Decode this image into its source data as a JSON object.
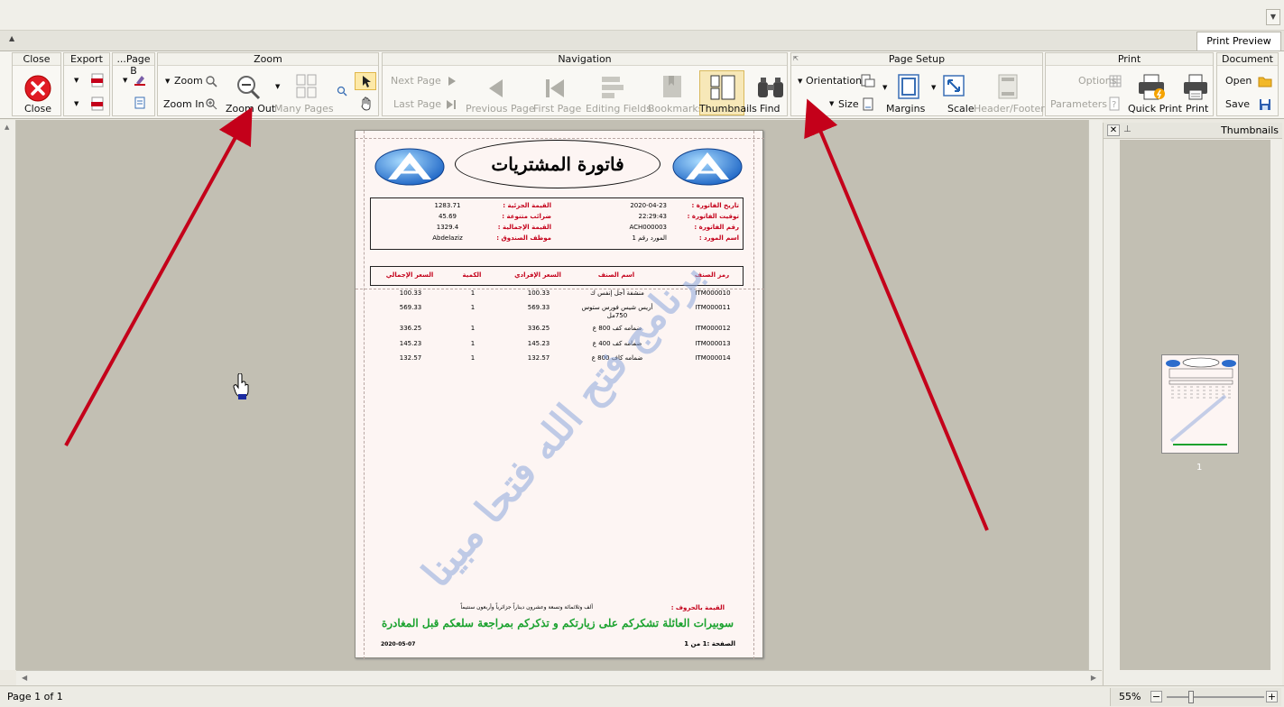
{
  "tab": {
    "label": "Print Preview"
  },
  "groups": {
    "close": {
      "title": "Close",
      "close_label": "Close"
    },
    "export": {
      "title": "Export"
    },
    "pageb": {
      "title": "...Page B"
    },
    "zoom": {
      "title": "Zoom",
      "zoom_label": "Zoom",
      "zoom_in_label": "Zoom In",
      "zoom_out_label": "Zoom Out",
      "many_pages_label": "Many Pages"
    },
    "navigation": {
      "title": "Navigation",
      "next_page": "Next Page",
      "last_page": "Last Page",
      "previous_page": "Previous Page",
      "first_page": "First Page",
      "editing_fields": "Editing Fields",
      "bookmarks": "Bookmarks",
      "thumbnails": "Thumbnails",
      "find": "Find"
    },
    "pagesetup": {
      "title": "Page Setup",
      "orientation": "Orientation",
      "size": "Size",
      "margins": "Margins",
      "scale": "Scale",
      "header_footer": "Header/Footer"
    },
    "print": {
      "title": "Print",
      "options": "Options",
      "parameters": "Parameters",
      "quick_print": "Quick Print",
      "print": "Print"
    },
    "document": {
      "title": "Document",
      "open": "Open",
      "save": "Save"
    }
  },
  "thumbnails_panel": {
    "title": "Thumbnails",
    "page_number": "1"
  },
  "status": {
    "page_info": "Page 1 of 1",
    "zoom": "55%"
  },
  "invoice": {
    "title": "فاتورة المشتريات",
    "info_right": [
      {
        "label": "تاريخ الفاتورة :",
        "value": "2020-04-23"
      },
      {
        "label": "توقيت الفاتورة :",
        "value": "22:29:43"
      },
      {
        "label": "رقم الفاتورة :",
        "value": "ACH000003"
      },
      {
        "label": "اسم المورد :",
        "value": "المورد رقم 1"
      }
    ],
    "info_left": [
      {
        "label": "القيمة الجزئية :",
        "value": "1283.71"
      },
      {
        "label": "ضرائب متنوعة :",
        "value": "45.69"
      },
      {
        "label": "القيمة الإجمالية :",
        "value": "1329.4"
      },
      {
        "label": "موظف الصندوق :",
        "value": "Abdelaziz"
      }
    ],
    "columns": [
      "رمز الصنف",
      "اسم الصنف",
      "السعر الإفرادي",
      "الكمية",
      "السعر الإجمالي"
    ],
    "rows": [
      {
        "code": "ITM000010",
        "name": "منشفة أجل إنفس ك",
        "unit": "100.33",
        "qty": "1",
        "total": "100.33"
      },
      {
        "code": "ITM000011",
        "name": "أريس شيس فورس ستوس 750مل",
        "unit": "569.33",
        "qty": "1",
        "total": "569.33"
      },
      {
        "code": "ITM000012",
        "name": "ضمامه كف 800 ع",
        "unit": "336.25",
        "qty": "1",
        "total": "336.25"
      },
      {
        "code": "ITM000013",
        "name": "ضمامه كف 400 ع",
        "unit": "145.23",
        "qty": "1",
        "total": "145.23"
      },
      {
        "code": "ITM000014",
        "name": "ضمامه كاف 800 ع",
        "unit": "132.57",
        "qty": "1",
        "total": "132.57"
      }
    ],
    "amount_words_label": "القيمة بالحروف :",
    "amount_words": "ألف وثلاثمائة وتسعة وعشرون ديناراً جزائرياً وأربعون سنتيماً",
    "thanks": "سوبيرات العائلة تشكركم على زيارتكم و تذكركم بمراجعة سلعكم قبل المغادرة",
    "page_label": "الصفحة :1 من 1",
    "footer_date": "2020-05-07",
    "watermark": "برنامج فتح الله فتحا مبينا"
  },
  "colors": {
    "accent_red": "#c4001a",
    "thanks_green": "#1aa22e",
    "arrow_red": "#c4001a"
  }
}
